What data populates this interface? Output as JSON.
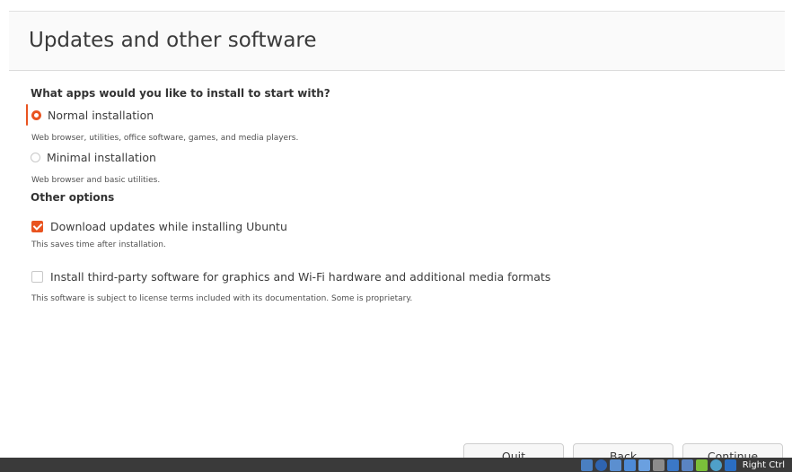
{
  "page": {
    "title": "Updates and other software"
  },
  "apps_section": {
    "heading": "What apps would you like to install to start with?",
    "options": [
      {
        "label": "Normal installation",
        "description": "Web browser, utilities, office software, games, and media players.",
        "selected": true
      },
      {
        "label": "Minimal installation",
        "description": "Web browser and basic utilities.",
        "selected": false
      }
    ]
  },
  "other_section": {
    "heading": "Other options",
    "options": [
      {
        "label": "Download updates while installing Ubuntu",
        "description": "This saves time after installation.",
        "checked": true
      },
      {
        "label": "Install third-party software for graphics and Wi-Fi hardware and additional media formats",
        "description": "This software is subject to license terms included with its documentation. Some is proprietary.",
        "checked": false
      }
    ]
  },
  "buttons": {
    "quit": "Quit",
    "back": "Back",
    "continue": "Continue"
  },
  "taskbar": {
    "host_key": "Right Ctrl",
    "icons": [
      "hard-disk-icon",
      "optical-drive-icon",
      "audio-icon",
      "network-icon",
      "usb-icon",
      "shared-folder-icon",
      "display-icon",
      "recording-icon",
      "mouse-integration-icon",
      "cpu-icon",
      "keyboard-capture-icon"
    ]
  },
  "colors": {
    "accent": "#e95420",
    "taskbar": "#3a3a3a"
  }
}
